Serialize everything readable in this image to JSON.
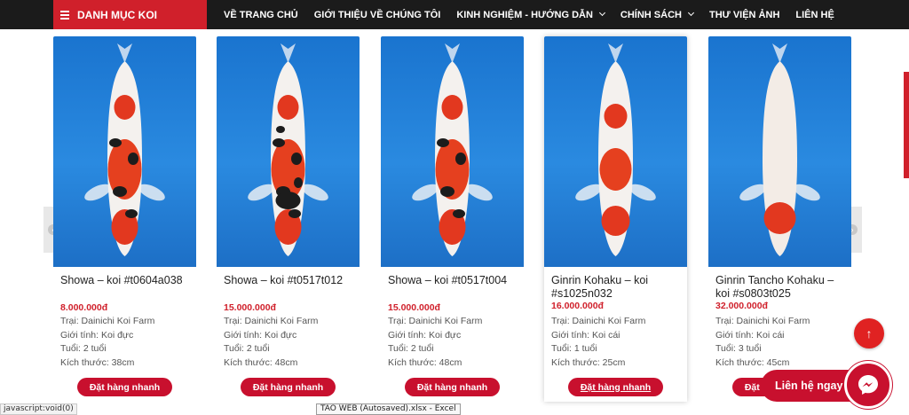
{
  "nav": {
    "category_label": "DANH MỤC KOI",
    "items": [
      {
        "label": "VỀ TRANG CHỦ",
        "has_dropdown": false
      },
      {
        "label": "GIỚI THIỆU VỀ CHÚNG TÔI",
        "has_dropdown": false
      },
      {
        "label": "KINH NGHIỆM - HƯỚNG DẪN",
        "has_dropdown": true
      },
      {
        "label": "CHÍNH SÁCH",
        "has_dropdown": true
      },
      {
        "label": "THƯ VIỆN ẢNH",
        "has_dropdown": false
      },
      {
        "label": "LIÊN HỆ",
        "has_dropdown": false
      }
    ]
  },
  "products": [
    {
      "title": "Showa – koi #t0604a038",
      "price": "8.000.000đ",
      "farm": "Trại: Dainichi Koi Farm",
      "gender": "Giới tính: Koi đực",
      "age": "Tuổi: 2 tuổi",
      "size": "Kích thước: 38cm",
      "button": "Đặt hàng nhanh",
      "variety": "showa"
    },
    {
      "title": "Showa – koi #t0517t012",
      "price": "15.000.000đ",
      "farm": "Trại: Dainichi Koi Farm",
      "gender": "Giới tính: Koi đực",
      "age": "Tuổi: 2 tuổi",
      "size": "Kích thước: 48cm",
      "button": "Đặt hàng nhanh",
      "variety": "showa-dark"
    },
    {
      "title": "Showa – koi #t0517t004",
      "price": "15.000.000đ",
      "farm": "Trại: Dainichi Koi Farm",
      "gender": "Giới tính: Koi đực",
      "age": "Tuổi: 2 tuổi",
      "size": "Kích thước: 48cm",
      "button": "Đặt hàng nhanh",
      "variety": "showa-red"
    },
    {
      "title": "Ginrin Kohaku – koi #s1025n032",
      "price": "16.000.000đ",
      "farm": "Trại: Dainichi Koi Farm",
      "gender": "Giới tính: Koi cái",
      "age": "Tuổi: 1 tuổi",
      "size": "Kích thước: 25cm",
      "button": "Đặt hàng nhanh",
      "variety": "kohaku"
    },
    {
      "title": "Ginrin Tancho Kohaku – koi #s0803t025",
      "price": "32.000.000đ",
      "farm": "Trại: Dainichi Koi Farm",
      "gender": "Giới tính: Koi cái",
      "age": "Tuổi: 3 tuổi",
      "size": "Kích thước: 45cm",
      "button": "Đặt hàng nhanh",
      "variety": "tancho"
    }
  ],
  "floating": {
    "scroll_top_icon": "arrow-up-icon",
    "scroll_top_glyph": "↑",
    "contact_label": "Liên hệ ngay",
    "messenger_icon": "messenger-icon"
  },
  "status_bar": {
    "link_text": "javascript:void(0)",
    "taskbar_tooltip": "TAO WEB (Autosaved).xlsx - Excel"
  },
  "colors": {
    "brand_red": "#d0202b",
    "nav_bg": "#1b1b1b",
    "price_red": "#d0202b",
    "water_blue": "#1a74cf"
  }
}
